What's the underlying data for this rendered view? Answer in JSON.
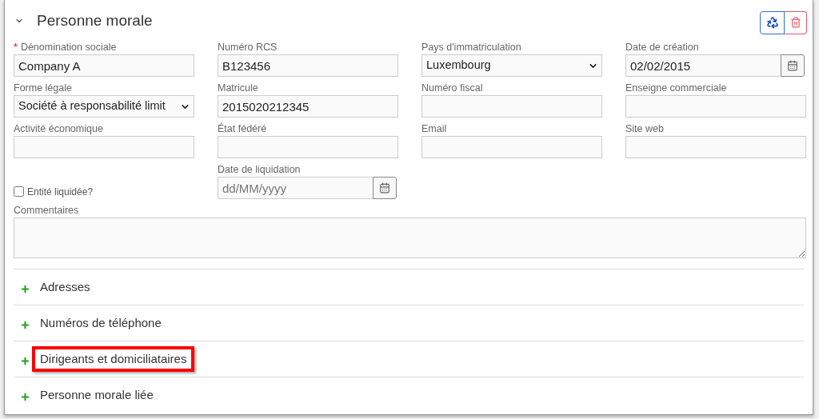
{
  "panel": {
    "title": "Personne morale",
    "expanded": true
  },
  "actions": [
    {
      "kind": "recycle"
    },
    {
      "kind": "delete"
    }
  ],
  "fields": [
    {
      "kind": "text",
      "label": "Dénomination sociale",
      "required_mark": "*",
      "value": "Company A"
    },
    {
      "kind": "text",
      "label": "Numéro RCS",
      "value": "B123456"
    },
    {
      "kind": "select",
      "label": "Pays d'immatriculation",
      "value": "Luxembourg"
    },
    {
      "kind": "date",
      "label": "Date de création",
      "value": "02/02/2015"
    },
    {
      "kind": "select",
      "label": "Forme légale",
      "value": "Société à responsabilité limit"
    },
    {
      "kind": "text",
      "label": "Matricule",
      "value": "2015020212345"
    },
    {
      "kind": "text",
      "label": "Numéro fiscal"
    },
    {
      "kind": "text",
      "label": "Enseigne commerciale"
    },
    {
      "kind": "text",
      "label": "Activité économique"
    },
    {
      "kind": "text",
      "label": "État fédéré"
    },
    {
      "kind": "text",
      "label": "Email"
    },
    {
      "kind": "text",
      "label": "Site web"
    },
    {
      "kind": "checkbox",
      "label": "Entité liquidée?",
      "checked": false
    },
    {
      "kind": "date",
      "label": "Date de liquidation",
      "placeholder": "dd/MM/yyyy"
    }
  ],
  "comments": {
    "label": "Commentaires"
  },
  "sections": [
    {
      "label": "Adresses",
      "expanded": false,
      "highlighted": false
    },
    {
      "label": "Numéros de téléphone",
      "expanded": false,
      "highlighted": false
    },
    {
      "label": "Dirigeants et domiciliataires",
      "expanded": false,
      "highlighted": true
    },
    {
      "label": "Personne morale liée",
      "expanded": false,
      "highlighted": false
    }
  ]
}
